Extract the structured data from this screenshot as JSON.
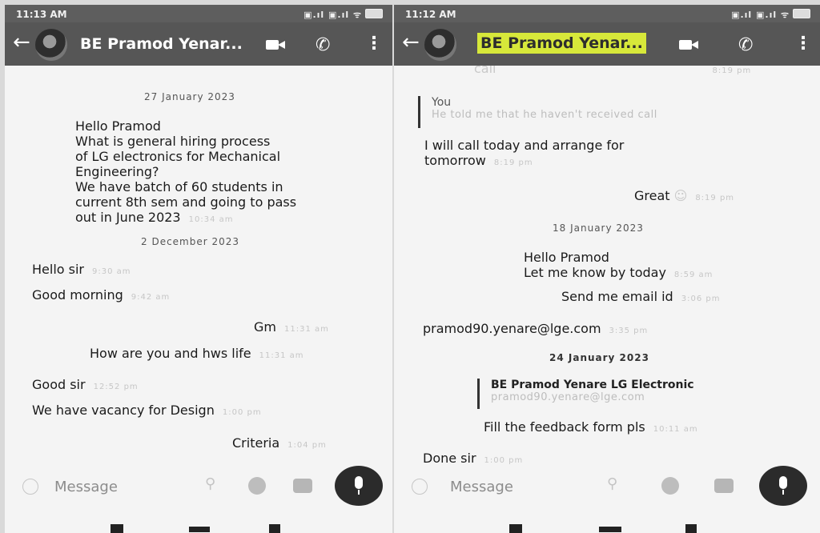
{
  "left": {
    "status": {
      "time": "11:13 AM",
      "icons": "▣.ıl ▣.ıl ᯤ"
    },
    "header": {
      "back": "←",
      "contact": "BE Pramod Yenar..."
    },
    "messages": {
      "date1": "27 January 2023",
      "m1": "Hello Pramod\nWhat is general hiring process\nof LG electronics for Mechanical\nEngineering?\nWe have batch of 60 students in\ncurrent 8th sem and going to pass\nout in June 2023",
      "m1_time": "10:34 am",
      "date2": "2 December 2023",
      "m2": "Hello sir",
      "m2_time": "9:30 am",
      "m3": "Good morning",
      "m3_time": "9:42 am",
      "m4": "Gm",
      "m4_time": "11:31 am",
      "m5": "How are you and hws life",
      "m5_time": "11:31 am",
      "m6": "Good sir",
      "m6_time": "12:52 pm",
      "m7": "We have vacancy for Design",
      "m7_time": "1:00 pm",
      "m8": "Criteria",
      "m8_time": "1:04 pm"
    },
    "input": {
      "placeholder": "Message"
    }
  },
  "right": {
    "status": {
      "time": "11:12 AM",
      "icons": "▣.ıl ▣.ıl ᯤ"
    },
    "header": {
      "back": "←",
      "contact": "BE Pramod Yenar..."
    },
    "messages": {
      "top": "call",
      "top_time": "8:19 pm",
      "q1_who": "You",
      "q1_txt": "He told me that he haven't received call",
      "m1": "I will call today and arrange for\ntomorrow",
      "m1_time": "8:19 pm",
      "m2": "Great",
      "m2_time": "8:19 pm",
      "date1": "18 January 2023",
      "m3": "Hello Pramod\nLet me know by today",
      "m3_time": "8:59 am",
      "m4": "Send me email id",
      "m4_time": "3:06 pm",
      "m5": "pramod90.yenare@lge.com",
      "m5_time": "3:35 pm",
      "date2": "24 January 2023",
      "q2_who": "BE Pramod Yenare LG Electronic",
      "q2_txt": "pramod90.yenare@lge.com",
      "m6": "Fill the feedback form pls",
      "m6_time": "10:11 am",
      "m7": "Done sir",
      "m7_time": "1:00 pm"
    },
    "input": {
      "placeholder": "Message"
    }
  }
}
